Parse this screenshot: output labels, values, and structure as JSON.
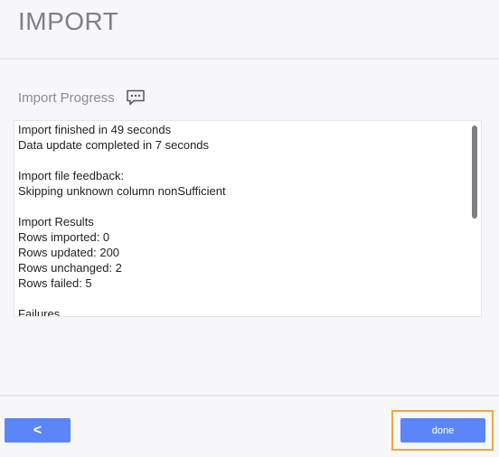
{
  "header": {
    "title": "IMPORT"
  },
  "section": {
    "title": "Import Progress",
    "icon": "comment-icon"
  },
  "log": {
    "lines": [
      "Import finished in 49 seconds",
      "Data update completed in 7 seconds",
      "",
      "Import file feedback:",
      "Skipping unknown column nonSufficient",
      "",
      "Import Results",
      "Rows imported: 0",
      "Rows updated: 200",
      "Rows unchanged: 2",
      "Rows failed: 5",
      "",
      "Failures"
    ]
  },
  "footer": {
    "back_label": "<",
    "done_label": "done"
  },
  "colors": {
    "button_bg": "#5a86f7",
    "highlight": "#f2a73c",
    "scrollbar": "#7d7f84"
  }
}
